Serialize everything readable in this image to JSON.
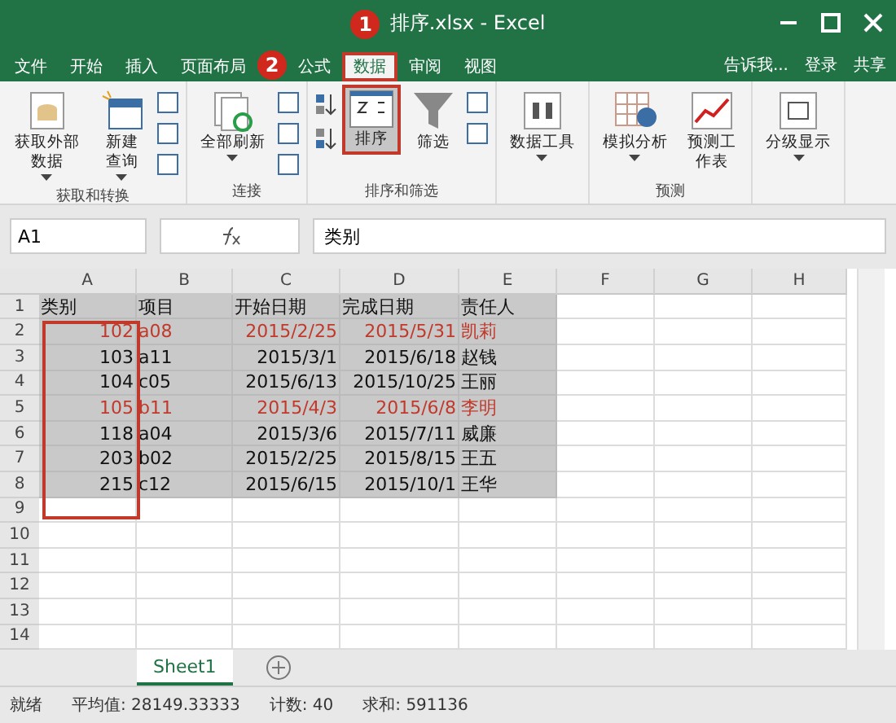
{
  "window": {
    "title": "排序.xlsx - Excel"
  },
  "tabs": [
    {
      "label": "文件",
      "selected": false
    },
    {
      "label": "开始",
      "selected": false
    },
    {
      "label": "插入",
      "selected": false
    },
    {
      "label": "页面布局",
      "selected": false
    },
    {
      "label": "公式",
      "selected": false
    },
    {
      "label": "数据",
      "selected": true
    },
    {
      "label": "审阅",
      "selected": false
    },
    {
      "label": "视图",
      "selected": false
    }
  ],
  "tell_me": "告诉我...",
  "login": "登录",
  "share": "共享",
  "ribbon_groups": [
    {
      "label": "获取和转换",
      "buttons": [
        {
          "label": "获取外部数据",
          "kind": "db",
          "selected": false,
          "dropdown": true
        },
        {
          "label": "新建查询",
          "kind": "table",
          "selected": false,
          "dropdown": true
        }
      ]
    },
    {
      "label": "连接",
      "buttons": [
        {
          "label": "全部刷新",
          "kind": "refresh",
          "selected": false,
          "dropdown": true
        }
      ]
    },
    {
      "label": "排序和筛选",
      "buttons": [
        {
          "label": "排序",
          "kind": "sort",
          "selected": true,
          "dropdown": false
        },
        {
          "label": "筛选",
          "kind": "filter",
          "selected": false,
          "dropdown": false
        }
      ]
    },
    {
      "buttons": [
        {
          "label": "数据工具",
          "kind": "tools",
          "selected": false,
          "dropdown": true
        }
      ]
    },
    {
      "label": "预测",
      "buttons": [
        {
          "label": "模拟分析",
          "kind": "whatif",
          "selected": false,
          "dropdown": true
        },
        {
          "label": "预测工作表",
          "kind": "forecast",
          "selected": false,
          "dropdown": false
        }
      ]
    },
    {
      "buttons": [
        {
          "label": "分级显示",
          "kind": "outline",
          "selected": false,
          "dropdown": true
        }
      ]
    }
  ],
  "name_box": "A1",
  "formula": "类别",
  "columns": [
    "A",
    "B",
    "C",
    "D",
    "E",
    "F",
    "G",
    "H"
  ],
  "rows": [
    {
      "n": "1",
      "cells": [
        "类别",
        "项目",
        "开始日期",
        "完成日期",
        "责任人"
      ],
      "highlighted": false
    },
    {
      "n": "2",
      "cells": [
        "102",
        "a08",
        "2015/2/25",
        "2015/5/31",
        "凯莉"
      ],
      "highlighted": true
    },
    {
      "n": "3",
      "cells": [
        "103",
        "a11",
        "2015/3/1",
        "2015/6/18",
        "赵钱"
      ],
      "highlighted": false
    },
    {
      "n": "4",
      "cells": [
        "104",
        "c05",
        "2015/6/13",
        "2015/10/25",
        "王丽"
      ],
      "highlighted": false
    },
    {
      "n": "5",
      "cells": [
        "105",
        "b11",
        "2015/4/3",
        "2015/6/8",
        "李明"
      ],
      "highlighted": true
    },
    {
      "n": "6",
      "cells": [
        "118",
        "a04",
        "2015/3/6",
        "2015/7/11",
        "威廉"
      ],
      "highlighted": false
    },
    {
      "n": "7",
      "cells": [
        "203",
        "b02",
        "2015/2/25",
        "2015/8/15",
        "王五"
      ],
      "highlighted": false
    },
    {
      "n": "8",
      "cells": [
        "215",
        "c12",
        "2015/6/15",
        "2015/10/1",
        "王华"
      ],
      "highlighted": false
    }
  ],
  "empty_rows": [
    "9",
    "10",
    "11",
    "12",
    "13",
    "14"
  ],
  "sheet_tabs": [
    {
      "label": "Sheet1",
      "selected": true
    }
  ],
  "status_bar": {
    "state": "就绪",
    "average": "平均值: 28149.33333",
    "count": "计数: 40",
    "sum": "求和: 591136"
  },
  "annotations": [
    "1",
    "2"
  ]
}
